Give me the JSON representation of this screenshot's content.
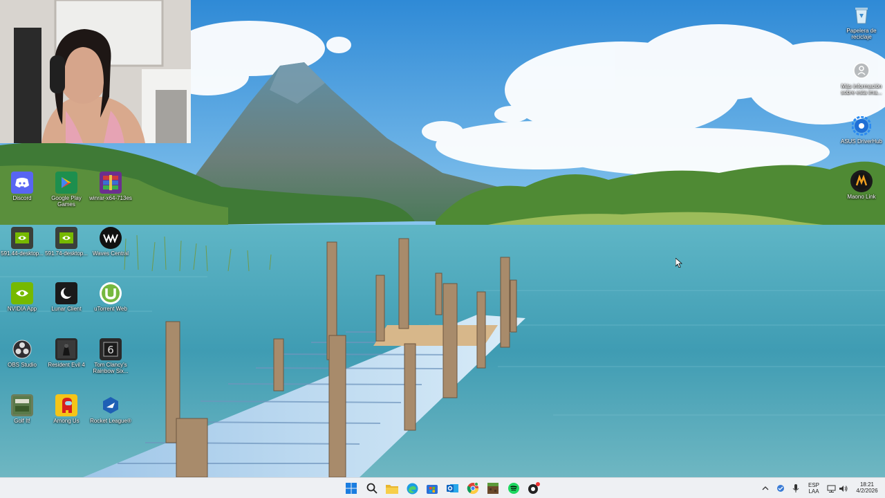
{
  "desktop": {
    "icons": [
      {
        "label": "Discord",
        "icon": "discord-icon"
      },
      {
        "label": "Google Play Games",
        "icon": "google-play-games-icon"
      },
      {
        "label": "winrar-x64-713es",
        "icon": "winrar-icon"
      },
      {
        "label": "591.44-desktop...",
        "icon": "nvidia-driver-icon"
      },
      {
        "label": "591.74-desktop...",
        "icon": "nvidia-driver-icon"
      },
      {
        "label": "Waves Central",
        "icon": "waves-icon"
      },
      {
        "label": "NVIDIA App",
        "icon": "nvidia-icon"
      },
      {
        "label": "Lunar Client",
        "icon": "lunar-client-icon"
      },
      {
        "label": "uTorrent Web",
        "icon": "utorrent-icon"
      },
      {
        "label": "OBS Studio",
        "icon": "obs-icon"
      },
      {
        "label": "Resident Evil 4",
        "icon": "resident-evil-icon"
      },
      {
        "label": "Tom Clancy's Rainbow Six...",
        "icon": "rainbow-six-icon"
      },
      {
        "label": "Golf It!",
        "icon": "golf-it-icon"
      },
      {
        "label": "Among Us",
        "icon": "among-us-icon"
      },
      {
        "label": "Rocket League®",
        "icon": "rocket-league-icon"
      }
    ],
    "right_icons": [
      {
        "label": "Papelera de reciclaje",
        "icon": "recycle-bin-icon"
      },
      {
        "label": "Más información sobre esta ima...",
        "icon": "spotlight-info-icon"
      },
      {
        "label": "ASUS DriverHub",
        "icon": "asus-driverhub-icon"
      },
      {
        "label": "Maono Link",
        "icon": "maono-link-icon"
      }
    ]
  },
  "taskbar": {
    "apps": [
      "start-icon",
      "search-icon",
      "file-explorer-icon",
      "edge-icon",
      "store-icon",
      "outlook-icon",
      "chrome-icon",
      "minecraft-icon",
      "spotify-icon",
      "recording-app-icon"
    ],
    "tray": {
      "language_top": "ESP",
      "language_bottom": "LAA",
      "time": "18:21",
      "date": "4/2/2026"
    }
  },
  "colors": {
    "taskbar_bg": "#eef0f3",
    "sky": "#3f97d8",
    "water": "#3e9bb0"
  }
}
